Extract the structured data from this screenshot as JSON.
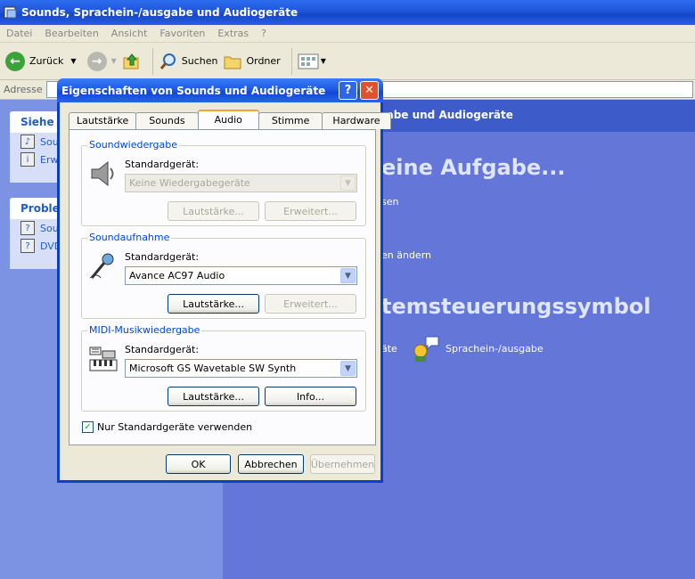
{
  "window": {
    "title": "Sounds, Sprachein-/ausgabe und Audiogeräte"
  },
  "menu": [
    "Datei",
    "Bearbeiten",
    "Ansicht",
    "Favoriten",
    "Extras",
    "?"
  ],
  "toolbar": {
    "back": "Zurück",
    "search": "Suchen",
    "folders": "Ordner"
  },
  "address": {
    "label": "Adresse"
  },
  "left": {
    "see_also": {
      "title": "Siehe a",
      "items": [
        "Sou",
        "Erw"
      ]
    },
    "problems": {
      "title": "Problem",
      "items": [
        "Sou",
        "DVD"
      ]
    }
  },
  "right": {
    "header": "gabe und Audiogeräte",
    "task_heading": "eine Aufgabe...",
    "link1": "sen",
    "link2": "en ändern",
    "symbol_heading": "temsteuerungssymbol",
    "link3": "äte",
    "link4": "Sprachein-/ausgabe"
  },
  "dialog": {
    "title": "Eigenschaften von Sounds und Audiogeräte",
    "tabs": [
      "Lautstärke",
      "Sounds",
      "Audio",
      "Stimme",
      "Hardware"
    ],
    "active_tab": "Audio",
    "playback": {
      "title": "Soundwiedergabe",
      "label": "Standardgerät:",
      "device": "Keine Wiedergabegeräte",
      "volume": "Lautstärke...",
      "advanced": "Erweitert..."
    },
    "recording": {
      "title": "Soundaufnahme",
      "label": "Standardgerät:",
      "device": "Avance AC97 Audio",
      "volume": "Lautstärke...",
      "advanced": "Erweitert..."
    },
    "midi": {
      "title": "MIDI-Musikwiedergabe",
      "label": "Standardgerät:",
      "device": "Microsoft GS Wavetable SW Synth",
      "volume": "Lautstärke...",
      "info": "Info..."
    },
    "default_only": {
      "label": "Nur Standardgeräte verwenden",
      "checked": true
    },
    "ok": "OK",
    "cancel": "Abbrechen",
    "apply": "Übernehmen"
  }
}
